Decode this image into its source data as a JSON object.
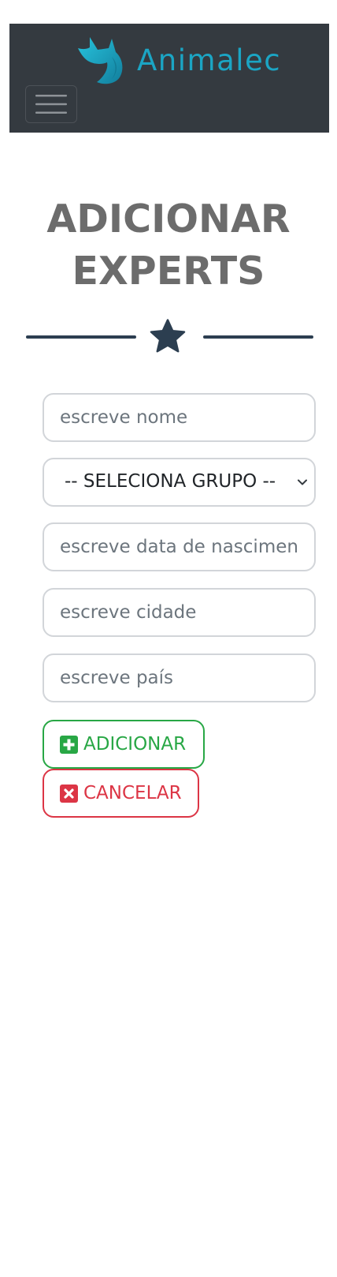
{
  "navbar": {
    "brand_name": "Animalec",
    "logo_icon": "fox-head-icon",
    "toggler_icon": "hamburger-menu-icon",
    "background_color": "#343a40",
    "brand_color": "#1ba5c4"
  },
  "page": {
    "title_line1": "ADICIONAR",
    "title_line2": "EXPERTS",
    "divider_icon": "star-icon",
    "title_color": "#6c6c6c",
    "divider_color": "#2c3e50"
  },
  "form": {
    "name_placeholder": "escreve nome",
    "group_selected": "-- SELECIONA GRUPO --",
    "birthdate_placeholder": "escreve data de nascimento",
    "city_placeholder": "escreve cidade",
    "country_placeholder": "escreve país",
    "add_label": "ADICIONAR",
    "add_icon": "plus-square-icon",
    "add_color": "#28a745",
    "cancel_label": "CANCELAR",
    "cancel_icon": "x-square-icon",
    "cancel_color": "#dc3545"
  }
}
